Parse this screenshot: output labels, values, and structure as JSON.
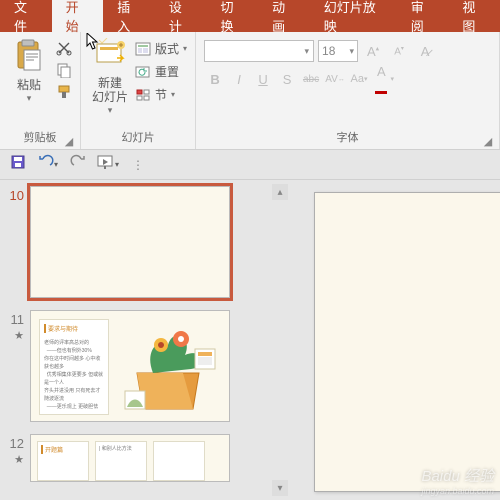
{
  "tabs": {
    "file": "文件",
    "home": "开始",
    "insert": "插入",
    "design": "设计",
    "transition": "切换",
    "animation": "动画",
    "slideshow": "幻灯片放映",
    "review": "审阅",
    "view": "视图"
  },
  "clipboard": {
    "paste": "粘贴",
    "group_label": "剪贴板"
  },
  "slides": {
    "new_slide": "新建\n幻灯片",
    "layout": "版式",
    "reset": "重置",
    "section": "节",
    "group_label": "幻灯片"
  },
  "font": {
    "family_placeholder": "",
    "size_value": "18",
    "bold": "B",
    "italic": "I",
    "underline": "U",
    "strike": "S",
    "shadow": "abc",
    "spacing": "AV",
    "case": "Aa",
    "color": "A",
    "group_label": "字体"
  },
  "thumbs": {
    "n10": "10",
    "n11": "11",
    "n12": "12",
    "slide11_title": "要求与期待",
    "slide12_title": "开题篇"
  },
  "watermark": {
    "brand": "Baidu 经验",
    "url": "jingyan.baidu.com"
  }
}
